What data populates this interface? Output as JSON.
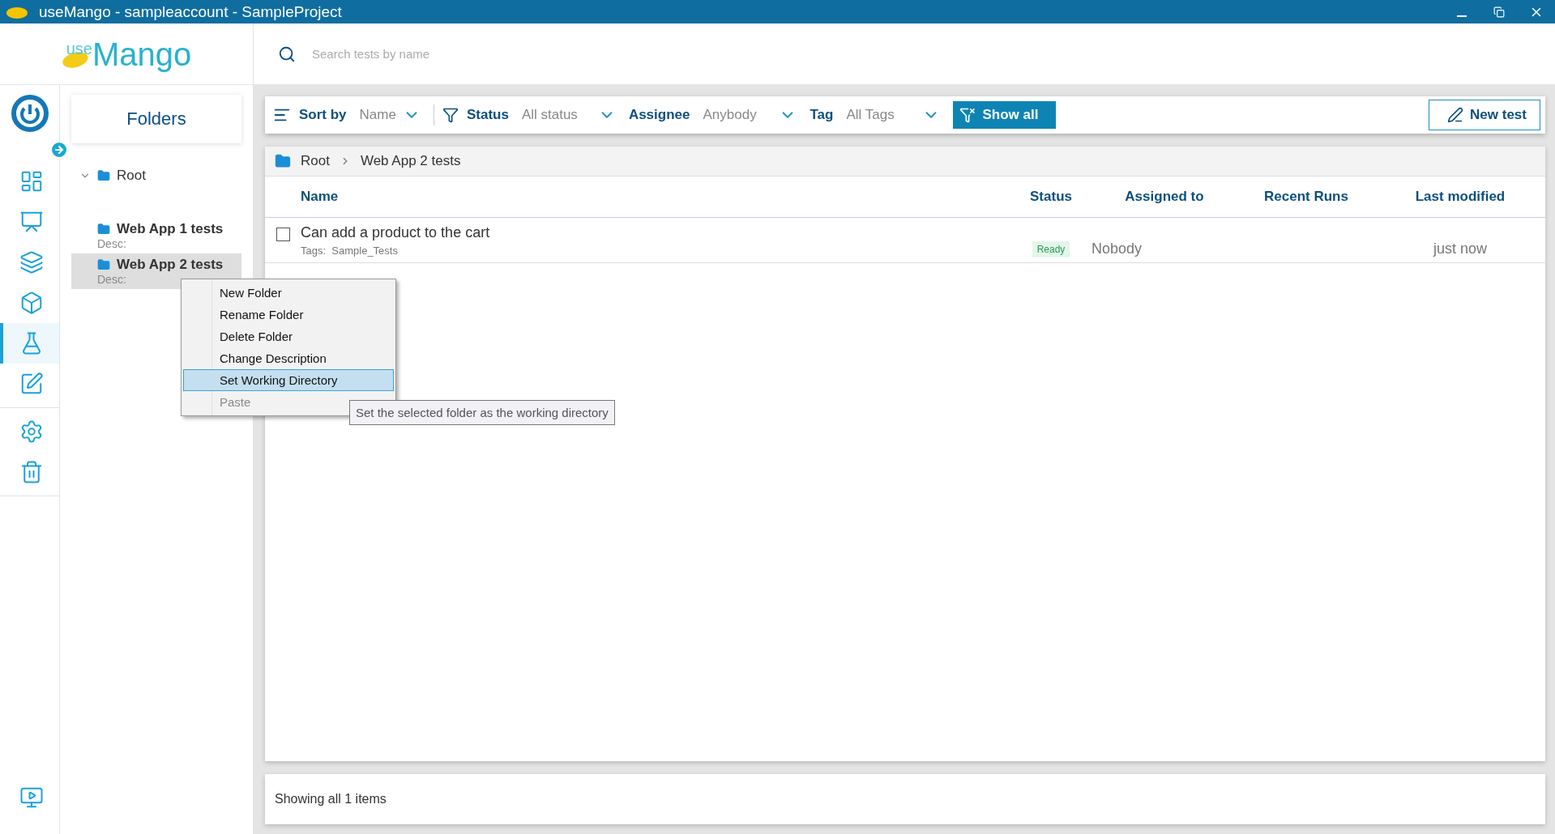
{
  "window": {
    "title": "useMango - sampleaccount - SampleProject"
  },
  "logo": {
    "prefix": "use",
    "name": "Mango"
  },
  "search": {
    "placeholder": "Search tests by name"
  },
  "nav_rail": [
    {
      "selected": false
    },
    {
      "selected": false
    },
    {
      "selected": false
    },
    {
      "selected": false
    },
    {
      "selected": true
    },
    {
      "selected": false
    },
    {
      "selected": false
    },
    {
      "selected": false
    },
    {
      "selected": false
    }
  ],
  "folders": {
    "title": "Folders",
    "tree": [
      {
        "label": "Root",
        "expanded": true,
        "selected": false,
        "children": [
          {
            "label": "Web App 1 tests",
            "desc": "Desc:",
            "selected": false
          },
          {
            "label": "Web App 2 tests",
            "desc": "Desc:",
            "selected": true
          }
        ]
      }
    ]
  },
  "toolbar": {
    "sort": {
      "label": "Sort by",
      "value": "Name"
    },
    "filters": [
      {
        "label": "Status",
        "value": "All status"
      },
      {
        "label": "Assignee",
        "value": "Anybody"
      },
      {
        "label": "Tag",
        "value": "All Tags"
      }
    ],
    "show_all": "Show all",
    "new_test": "New test"
  },
  "breadcrumb": [
    "Root",
    "Web App 2 tests"
  ],
  "table": {
    "columns": [
      "Name",
      "Status",
      "Assigned to",
      "Recent Runs",
      "Last modified"
    ],
    "rows": [
      {
        "checked": false,
        "name": "Can add a product to the cart",
        "tags_label": "Tags:",
        "tags": "Sample_Tests",
        "status": "Ready",
        "assigned_to": "Nobody",
        "last_modified": "just now"
      }
    ]
  },
  "footer": "Showing all 1 items",
  "context_menu": {
    "items": [
      {
        "label": "New Folder",
        "selected": false,
        "disabled": false
      },
      {
        "label": "Rename Folder",
        "selected": false,
        "disabled": false
      },
      {
        "label": "Delete Folder",
        "selected": false,
        "disabled": false
      },
      {
        "label": "Change Description",
        "selected": false,
        "disabled": false
      },
      {
        "label": "Set Working Directory",
        "selected": true,
        "disabled": false
      },
      {
        "label": "Paste",
        "selected": false,
        "disabled": true
      }
    ],
    "tooltip": "Set the selected folder as the working directory"
  }
}
